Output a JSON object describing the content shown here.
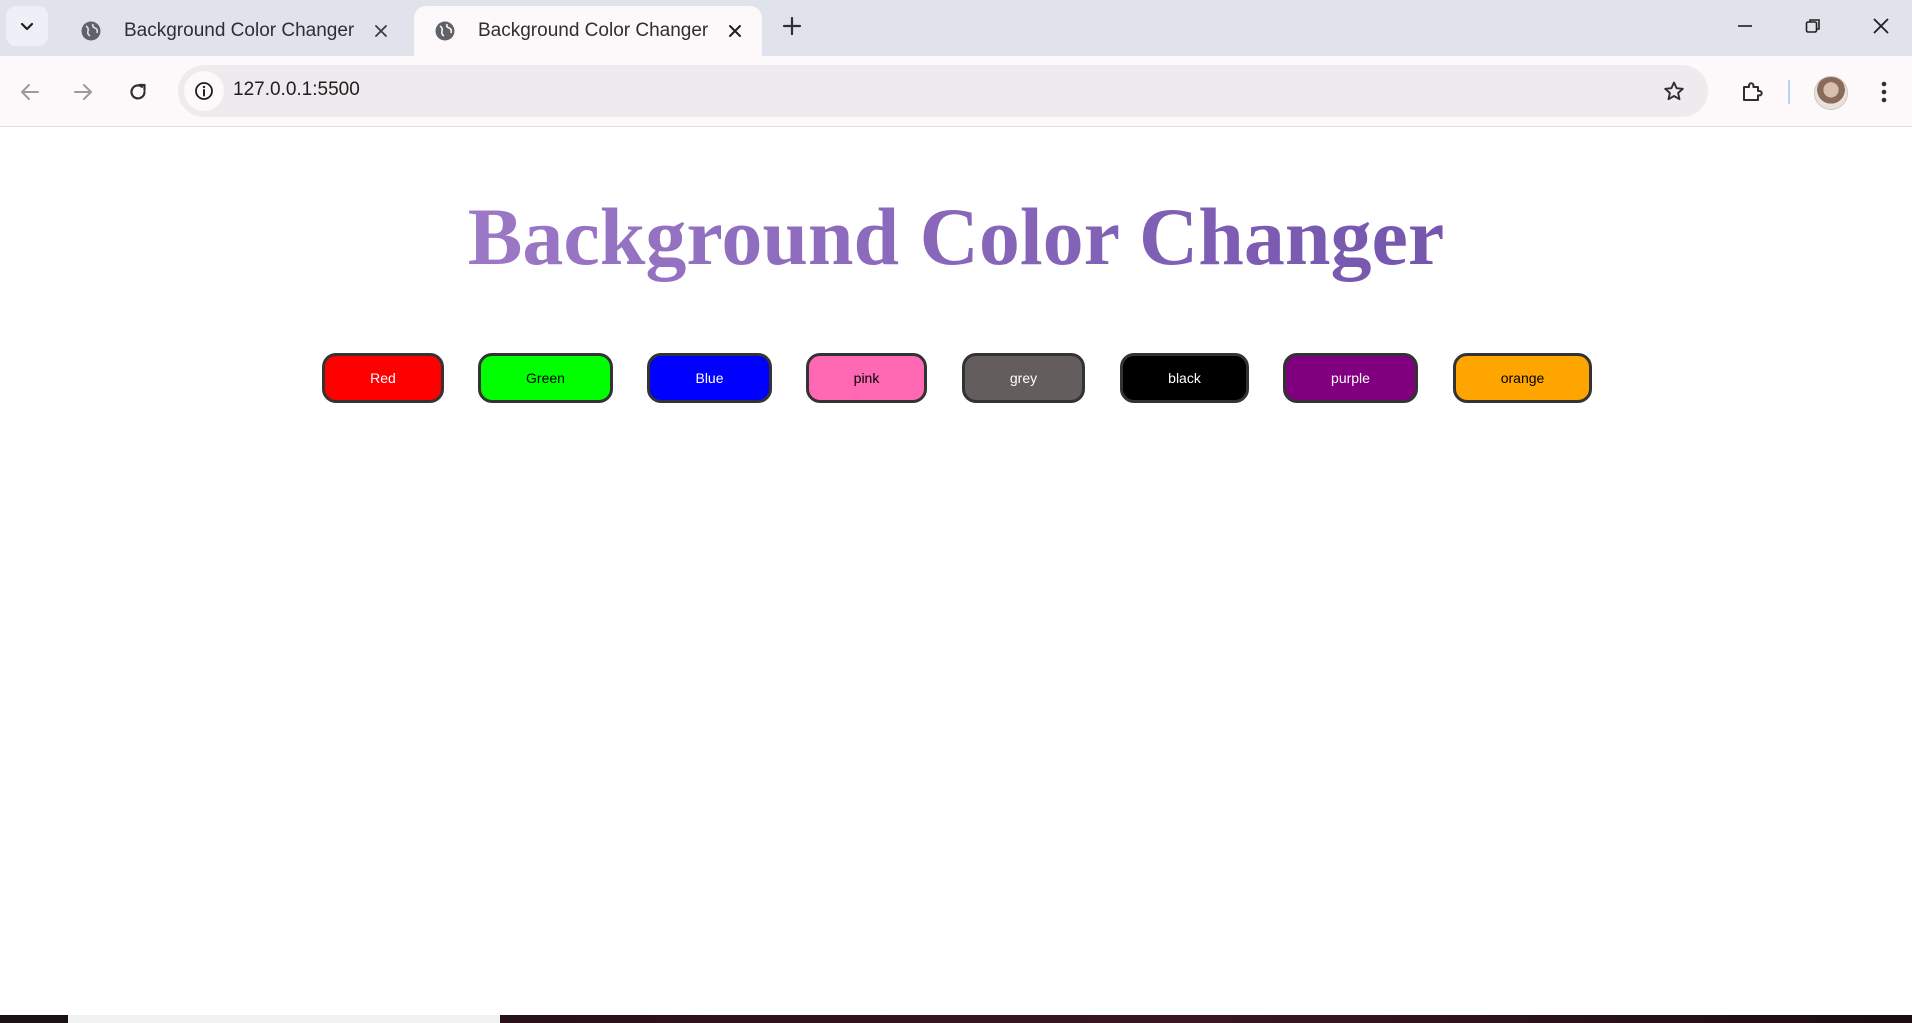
{
  "browser": {
    "tabs": [
      {
        "title": "Background Color Changer",
        "active": false
      },
      {
        "title": "Background Color Changer",
        "active": true
      }
    ],
    "url": "127.0.0.1:5500",
    "icons": {
      "tab_search": "chevron-down-icon",
      "favicon": "globe-icon",
      "tab_close": "close-icon",
      "new_tab": "plus-icon",
      "back": "arrow-left-icon",
      "forward": "arrow-right-icon",
      "reload": "reload-icon",
      "site_info": "info-icon",
      "bookmark": "star-icon",
      "extensions": "puzzle-icon",
      "menu": "kebab-menu-icon",
      "minimize": "minimize-icon",
      "restore": "restore-icon",
      "close_window": "close-icon"
    }
  },
  "page": {
    "heading": "Background Color Changer",
    "heading_colors": [
      "#9c78c6",
      "#7456ae"
    ],
    "buttons": [
      {
        "label": "Red",
        "bg": "#ff0000",
        "fg": "#ffffff"
      },
      {
        "label": "Green",
        "bg": "#00ff00",
        "fg": "#000000"
      },
      {
        "label": "Blue",
        "bg": "#0000ff",
        "fg": "#ffffff"
      },
      {
        "label": "pink",
        "bg": "#ff69b4",
        "fg": "#000000"
      },
      {
        "label": "grey",
        "bg": "#635d5d",
        "fg": "#ffffff"
      },
      {
        "label": "black",
        "bg": "#000000",
        "fg": "#ffffff"
      },
      {
        "label": "purple",
        "bg": "#800080",
        "fg": "#ffffff"
      },
      {
        "label": "orange",
        "bg": "#ffa500",
        "fg": "#000000"
      }
    ]
  }
}
